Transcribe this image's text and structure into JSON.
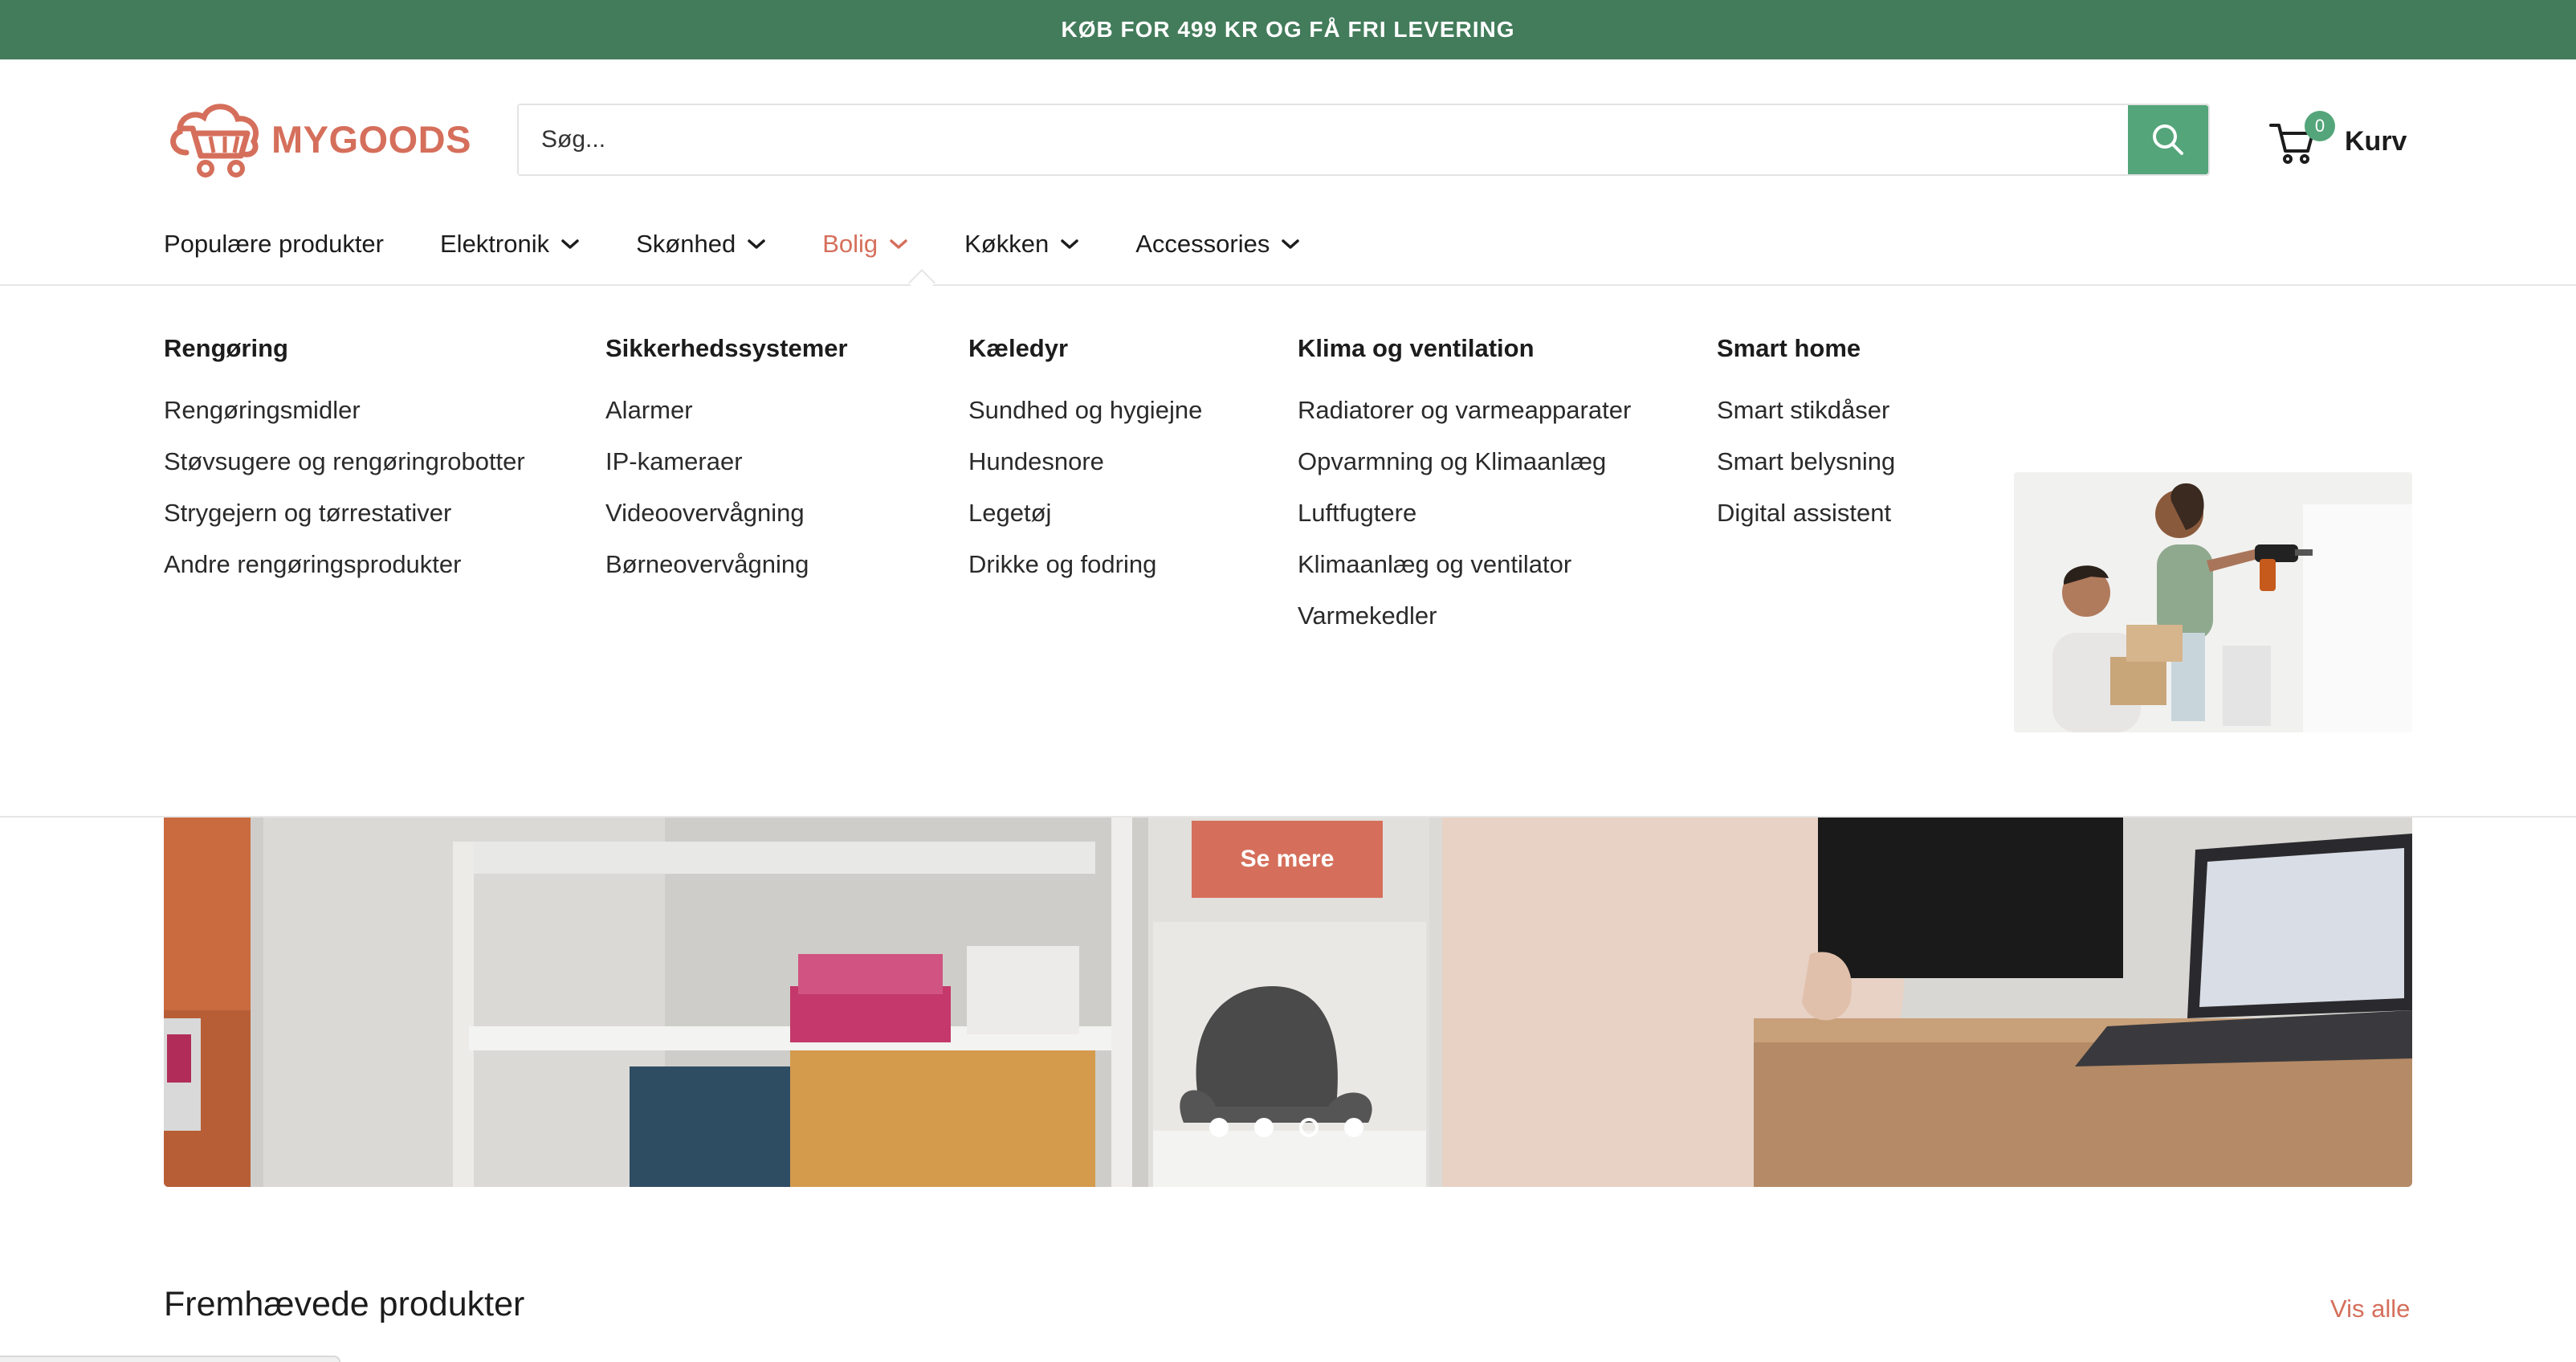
{
  "announcement": "KØB FOR 499 KR OG FÅ FRI LEVERING",
  "logo": {
    "text": "MYGOODS",
    "icon": "cart-cloud-logo-icon",
    "color": "#d56f5b"
  },
  "search": {
    "placeholder": "Søg...",
    "button_icon": "search-icon",
    "accent": "#54a57a"
  },
  "cart": {
    "count": "0",
    "label": "Kurv",
    "icon": "cart-icon"
  },
  "nav": {
    "items": [
      {
        "label": "Populære produkter",
        "dropdown": false
      },
      {
        "label": "Elektronik",
        "dropdown": true
      },
      {
        "label": "Skønhed",
        "dropdown": true
      },
      {
        "label": "Bolig",
        "dropdown": true,
        "active": true
      },
      {
        "label": "Køkken",
        "dropdown": true
      },
      {
        "label": "Accessories",
        "dropdown": true
      }
    ]
  },
  "mega_menu": {
    "columns": [
      {
        "title": "Rengøring",
        "links": [
          "Rengøringsmidler",
          "Støvsugere og rengøringrobotter",
          "Strygejern og tørrestativer",
          "Andre rengøringsprodukter"
        ]
      },
      {
        "title": "Sikkerhedssystemer",
        "links": [
          "Alarmer",
          "IP-kameraer",
          "Videoovervågning",
          "Børneovervågning"
        ]
      },
      {
        "title": "Kæledyr",
        "links": [
          "Sundhed og hygiejne",
          "Hundesnore",
          "Legetøj",
          "Drikke og fodring"
        ]
      },
      {
        "title": "Klima og ventilation",
        "links": [
          "Radiatorer og varmeapparater",
          "Opvarmning og Klimaanlæg",
          "Luftfugtere",
          "Klimaanlæg og ventilator",
          "Varmekedler"
        ]
      },
      {
        "title": "Smart home",
        "links": [
          "Smart stikdåser",
          "Smart belysning",
          "Digital assistent"
        ]
      }
    ]
  },
  "banner": {
    "button": "Se mere",
    "slides": 4,
    "current_slide": 3
  },
  "featured": {
    "title": "Fremhævede produkter",
    "view_all": "Vis alle"
  },
  "colors": {
    "brand": "#d56f5b",
    "green": "#437c5b",
    "accent": "#54a57a"
  }
}
